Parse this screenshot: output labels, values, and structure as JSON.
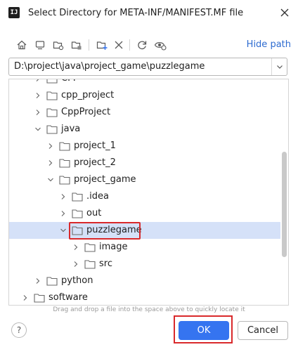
{
  "dialog": {
    "title": "Select Directory for META-INF/MANIFEST.MF file",
    "app_icon_text": "IJ"
  },
  "toolbar": {
    "buttons": [
      "home-icon",
      "desktop-icon",
      "project-folder-icon",
      "module-folder-icon",
      "new-folder-icon",
      "delete-icon",
      "refresh-icon",
      "show-hidden-icon"
    ],
    "hide_path_label": "Hide path"
  },
  "path": {
    "value": "D:\\project\\java\\project_game\\puzzlegame"
  },
  "tree": {
    "items": [
      {
        "label": "CPP",
        "depth": 2,
        "expanded": false
      },
      {
        "label": "cpp_project",
        "depth": 2,
        "expanded": false
      },
      {
        "label": "CppProject",
        "depth": 2,
        "expanded": false
      },
      {
        "label": "java",
        "depth": 2,
        "expanded": true
      },
      {
        "label": "project_1",
        "depth": 3,
        "expanded": false
      },
      {
        "label": "project_2",
        "depth": 3,
        "expanded": false
      },
      {
        "label": "project_game",
        "depth": 3,
        "expanded": true
      },
      {
        "label": ".idea",
        "depth": 4,
        "expanded": false
      },
      {
        "label": "out",
        "depth": 4,
        "expanded": false
      },
      {
        "label": "puzzlegame",
        "depth": 4,
        "expanded": true,
        "selected": true
      },
      {
        "label": "image",
        "depth": 5,
        "expanded": false
      },
      {
        "label": "src",
        "depth": 5,
        "expanded": false
      },
      {
        "label": "python",
        "depth": 2,
        "expanded": false
      },
      {
        "label": "software",
        "depth": 1,
        "expanded": false
      }
    ]
  },
  "hint": "Drag and drop a file into the space above to quickly locate it",
  "buttons": {
    "help": "?",
    "ok": "OK",
    "cancel": "Cancel"
  },
  "colors": {
    "accent": "#3574f0",
    "selection": "#d5e1f8",
    "annotation": "#d9292b",
    "link": "#2d6bd0"
  }
}
